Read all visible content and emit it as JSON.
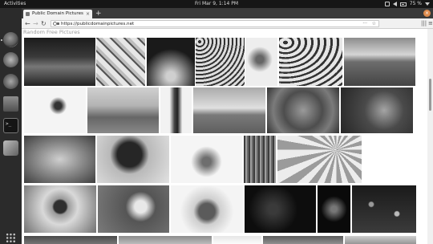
{
  "topbar": {
    "activities": "Activities",
    "clock": "Fri Mar  9,  1:14 PM",
    "battery": "75 %"
  },
  "browser": {
    "tab_title": "Public Domain Pictures",
    "new_tab": "+",
    "url": "https://publicdomainpictures.net"
  },
  "page": {
    "heading": "Random Free Pictures"
  },
  "icons": {
    "back": "←",
    "forward": "→",
    "reload": "↻",
    "more": "···",
    "bookmark": "☆",
    "library": "|||",
    "menu": "≡",
    "close": "×",
    "window_close": "×"
  },
  "gallery": [
    {
      "name": "photo-child-with-hat",
      "bg": "linear-gradient(180deg,#1b1b1b 0%,#3a3a3a 40%,#777 60%,#222 100%)"
    },
    {
      "name": "photo-ice-cream-drawings",
      "bg": "repeating-linear-gradient(45deg,#e6e6e6 0 6px,#555 6px 8px,#bdbdbd 8px 12px)"
    },
    {
      "name": "photo-christmas-tree",
      "bg": "radial-gradient(circle at 50% 80%,#cfcfcf 0 10%,#1a1a1a 60%)"
    },
    {
      "name": "photo-pattern-tiles",
      "bg": "repeating-radial-gradient(circle at 5px 5px,#333 0 2px,#ddd 2px 5px)"
    },
    {
      "name": "photo-birds-sketch",
      "bg": "radial-gradient(circle at 45% 45%,#666 0 12%,#eee 40%)"
    },
    {
      "name": "photo-lips-pattern",
      "bg": "repeating-radial-gradient(ellipse at 8px 6px,#333 0 3px,#e6e6e6 3px 8px)"
    },
    {
      "name": "photo-road-landscape",
      "bg": "linear-gradient(180deg,#8c8c8c 0%,#d5d5d5 35%,#6d6d6d 50%,#444 100%)"
    },
    {
      "name": "photo-fish-drawing",
      "bg": "radial-gradient(circle at 55% 40%,#333 0 8%,#f4f4f4 20%)"
    },
    {
      "name": "photo-village-landscape",
      "bg": "linear-gradient(180deg,#d0d0d0 0%,#b3b3b3 40%,#666 65%,#888 100%)"
    },
    {
      "name": "photo-woman-with-tablet",
      "bg": "linear-gradient(90deg,#f2f2f2 0%,#f2f2f2 30%,#444 45%,#222 55%,#f2f2f2 70%)"
    },
    {
      "name": "photo-field-clouds",
      "bg": "linear-gradient(180deg,#aaa 0%,#e0e0e0 45%,#7a7a7a 60%,#5e5e5e 100%)"
    },
    {
      "name": "photo-tabby-cat",
      "bg": "radial-gradient(circle at 50% 50%,#9a9a9a 0%,#4d4d4d 45%,#7b7b7b 70%,#333 100%)"
    },
    {
      "name": "photo-red-panda",
      "bg": "radial-gradient(circle at 60% 50%,#a5a5a5 0%,#4a4a4a 40%,#262626 100%)"
    },
    {
      "name": "photo-sleeping-dog",
      "bg": "radial-gradient(ellipse at 50% 50%,#cfcfcf 0%,#8c8c8c 45%,#3e3e3e 100%)"
    },
    {
      "name": "photo-flag",
      "bg": "radial-gradient(circle at 45% 40%,#262626 0 25%,#b9b9b9 40%,#e2e2e2 100%)"
    },
    {
      "name": "photo-desk-tools",
      "bg": "radial-gradient(circle at 50% 55%,#6e6e6e 0 10%,#f5f5f5 35%)"
    },
    {
      "name": "photo-tree-bark",
      "bg": "repeating-linear-gradient(90deg,#3d3d3d 0 2px,#9d9d9d 2px 4px,#6a6a6a 4px 6px)"
    },
    {
      "name": "photo-colored-pencils",
      "bg": "repeating-conic-gradient(from 0deg at 70% 30%,#ececec 0deg 10deg,#9b9b9b 10deg 20deg)"
    },
    {
      "name": "photo-sunflower",
      "bg": "radial-gradient(circle at 50% 45%,#2f2f2f 0 14%,#9a9a9a 18%,#d9d9d9 40%,#707070 100%)"
    },
    {
      "name": "photo-butterfly",
      "bg": "radial-gradient(circle at 60% 45%,#e8e8e8 0 12%,#555 30%,#7a7a7a 100%)"
    },
    {
      "name": "photo-sneakers",
      "bg": "radial-gradient(circle at 50% 55%,#5b5b5b 0 18%,#cfcfcf 30%,#f4f4f4 60%)"
    },
    {
      "name": "photo-dark-cave",
      "bg": "radial-gradient(circle at 40% 50%,#3a3a3a 0 10%,#0d0d0d 50%)"
    },
    {
      "name": "photo-lantern-dark",
      "bg": "radial-gradient(circle at 50% 50%,#777 0 10%,#0a0a0a 45%)"
    },
    {
      "name": "photo-bokeh-lights",
      "bg": "radial-gradient(circle at 30% 40%,#999 0 4%,transparent 6%),radial-gradient(circle at 70% 60%,#bbb 0 4%,transparent 6%),linear-gradient(#1a1a1a,#3b3b3b)"
    },
    {
      "name": "photo-bottom-1",
      "bg": "linear-gradient(#4a4a4a,#7d7d7d)"
    },
    {
      "name": "photo-bottom-2",
      "bg": "linear-gradient(#8a8a8a,#c7c7c7)"
    },
    {
      "name": "photo-bottom-3",
      "bg": "linear-gradient(#e6e6e6,#ffffff)"
    },
    {
      "name": "photo-bottom-4",
      "bg": "linear-gradient(#5a5a5a,#9a9a9a)"
    },
    {
      "name": "photo-bottom-5",
      "bg": "linear-gradient(#cfcfcf,#8a8a8a)"
    }
  ]
}
